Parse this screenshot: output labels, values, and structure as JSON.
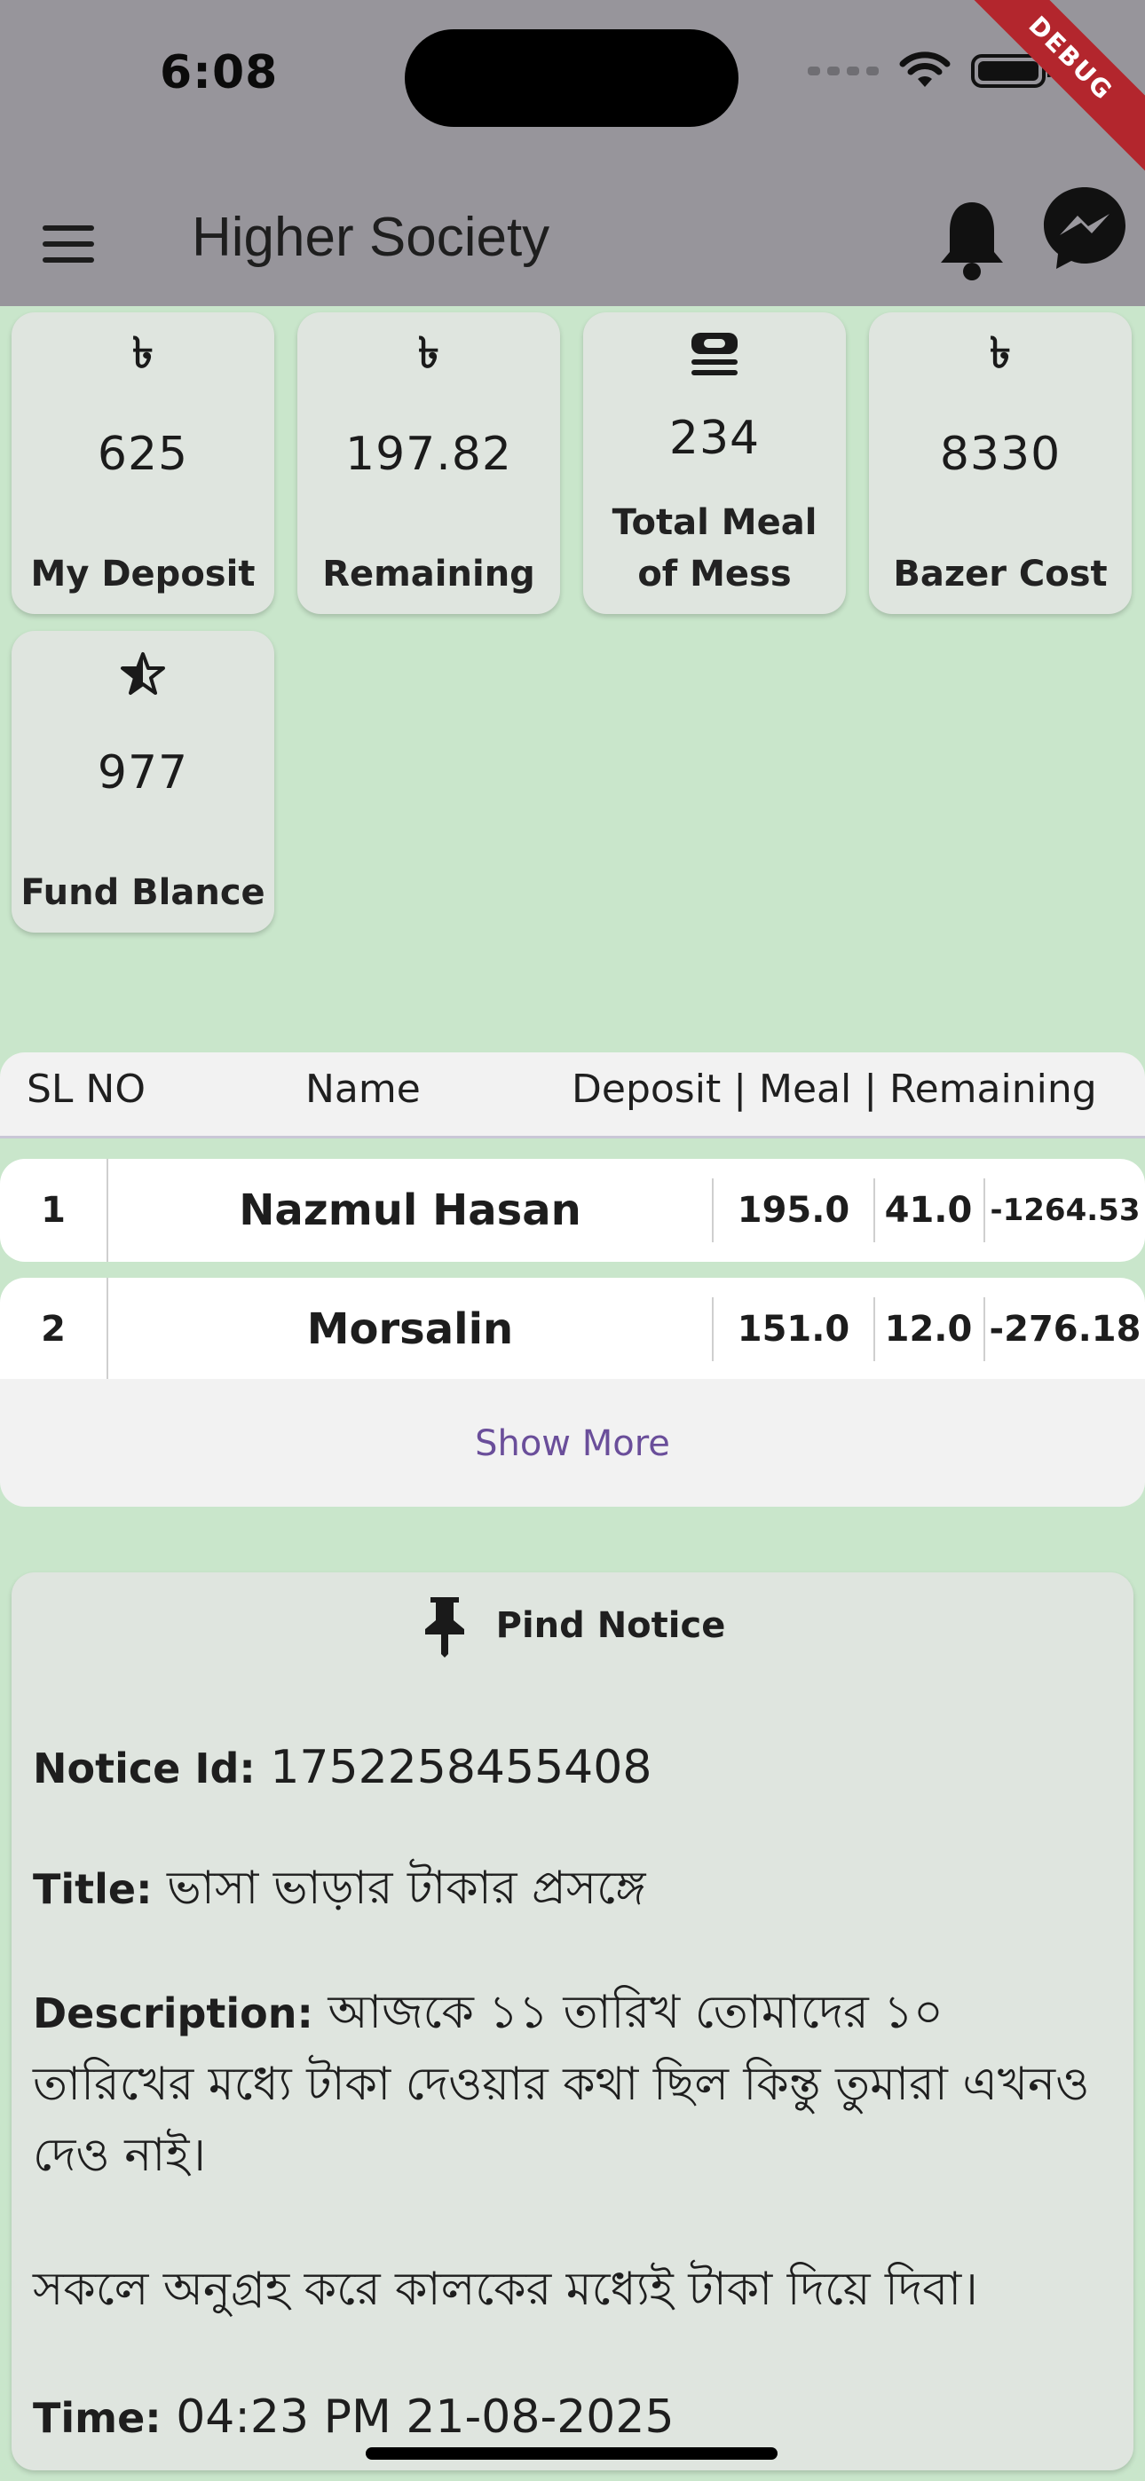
{
  "status": {
    "time": "6:08",
    "debug_label": "DEBUG"
  },
  "app_bar": {
    "title": "Higher Society"
  },
  "cards": [
    {
      "icon": "taka-icon",
      "icon_glyph": "৳",
      "value": "625",
      "label": "My Deposit"
    },
    {
      "icon": "taka-icon",
      "icon_glyph": "৳",
      "value": "197.82",
      "label": "Remaining"
    },
    {
      "icon": "meal-icon",
      "icon_glyph": "",
      "value": "234",
      "label": "Total Meal of Mess"
    },
    {
      "icon": "taka-icon",
      "icon_glyph": "৳",
      "value": "8330",
      "label": "Bazer Cost"
    },
    {
      "icon": "star-icon",
      "icon_glyph": "",
      "value": "977",
      "label": "Fund Blance"
    }
  ],
  "table": {
    "headers": {
      "sl": "SL NO",
      "name": "Name",
      "stats": "Deposit | Meal | Remaining"
    },
    "rows": [
      {
        "sl": "1",
        "name": "Nazmul Hasan",
        "deposit": "195.0",
        "meal": "41.0",
        "remaining": "-1264.53"
      },
      {
        "sl": "2",
        "name": "Morsalin",
        "deposit": "151.0",
        "meal": "12.0",
        "remaining": "-276.18"
      }
    ],
    "show_more": "Show More"
  },
  "notice": {
    "heading": "Pind Notice",
    "id_label": "Notice Id:",
    "id_value": "1752258455408",
    "title_label": "Title:",
    "title_value": "ভাসা ভাড়ার টাকার প্রসঙ্গে",
    "description_label": "Description:",
    "description_value": "আজকে ১১ তারিখ তোমাদের ১০ তারিখের মধ্যে টাকা দেওয়ার কথা ছিল কিন্তু তুমারা এখনও দেও নাই।",
    "description_extra": "সকলে অনুগ্রহ করে কালকের মধ্যেই টাকা দিয়ে দিবা।",
    "time_label": "Time:",
    "time_value": "04:23 PM 21-08-2025"
  }
}
